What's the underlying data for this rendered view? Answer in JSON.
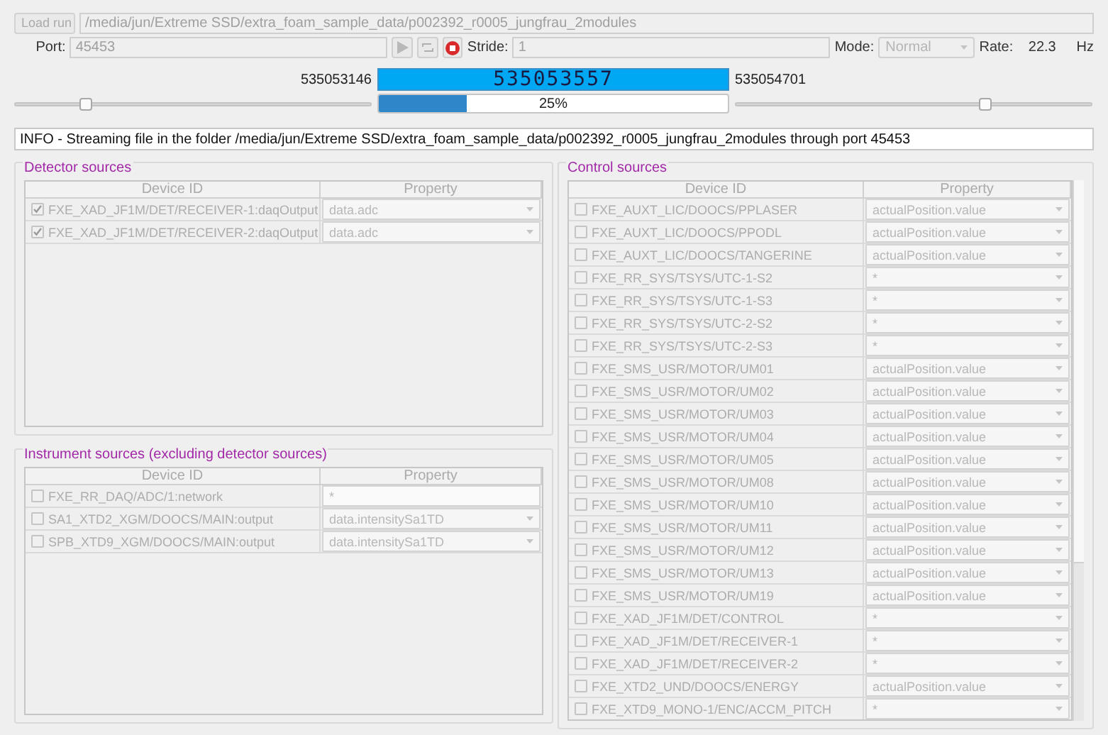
{
  "load_run_button": "Load run",
  "file_path": "/media/jun/Extreme SSD/extra_foam_sample_data/p002392_r0005_jungfrau_2modules",
  "port": {
    "label": "Port:",
    "value": "45453",
    "disabled": true
  },
  "stride": {
    "label": "Stride:",
    "value": "1",
    "disabled": true
  },
  "mode": {
    "label": "Mode:",
    "value": "Normal"
  },
  "rate": {
    "label": "Rate:",
    "value": "22.3",
    "unit": "Hz"
  },
  "stream": {
    "start": "535053146",
    "current": "535053557",
    "end": "535054701",
    "progress": {
      "level": 0.25,
      "label": "25%"
    },
    "start_slider": {
      "level": 0.2
    },
    "end_slider": {
      "level": 0.7
    }
  },
  "info": "INFO - Streaming file in the folder /media/jun/Extreme SSD/extra_foam_sample_data/p002392_r0005_jungfrau_2modules through port 45453",
  "detector_sources": {
    "title": "Detector sources",
    "columns": [
      "Device ID",
      "Property"
    ],
    "rows": [
      {
        "device": "FXE_XAD_JF1M/DET/RECEIVER-1:daqOutput",
        "checked": true,
        "property": "data.adc",
        "kind": "combo"
      },
      {
        "device": "FXE_XAD_JF1M/DET/RECEIVER-2:daqOutput",
        "checked": true,
        "property": "data.adc",
        "kind": "combo"
      }
    ]
  },
  "instrument_sources": {
    "title": "Instrument sources (excluding detector sources)",
    "columns": [
      "Device ID",
      "Property"
    ],
    "rows": [
      {
        "device": "FXE_RR_DAQ/ADC/1:network",
        "checked": false,
        "property": "*",
        "kind": "text"
      },
      {
        "device": "SA1_XTD2_XGM/DOOCS/MAIN:output",
        "checked": false,
        "property": "data.intensitySa1TD",
        "kind": "combo"
      },
      {
        "device": "SPB_XTD9_XGM/DOOCS/MAIN:output",
        "checked": false,
        "property": "data.intensitySa1TD",
        "kind": "combo"
      }
    ]
  },
  "control_sources": {
    "title": "Control sources",
    "columns": [
      "Device ID",
      "Property"
    ],
    "rows": [
      {
        "device": "FXE_AUXT_LIC/DOOCS/PPLASER",
        "checked": false,
        "property": "actualPosition.value",
        "kind": "combo"
      },
      {
        "device": "FXE_AUXT_LIC/DOOCS/PPODL",
        "checked": false,
        "property": "actualPosition.value",
        "kind": "combo"
      },
      {
        "device": "FXE_AUXT_LIC/DOOCS/TANGERINE",
        "checked": false,
        "property": "actualPosition.value",
        "kind": "combo"
      },
      {
        "device": "FXE_RR_SYS/TSYS/UTC-1-S2",
        "checked": false,
        "property": "*",
        "kind": "combo"
      },
      {
        "device": "FXE_RR_SYS/TSYS/UTC-1-S3",
        "checked": false,
        "property": "*",
        "kind": "combo"
      },
      {
        "device": "FXE_RR_SYS/TSYS/UTC-2-S2",
        "checked": false,
        "property": "*",
        "kind": "combo"
      },
      {
        "device": "FXE_RR_SYS/TSYS/UTC-2-S3",
        "checked": false,
        "property": "*",
        "kind": "combo"
      },
      {
        "device": "FXE_SMS_USR/MOTOR/UM01",
        "checked": false,
        "property": "actualPosition.value",
        "kind": "combo"
      },
      {
        "device": "FXE_SMS_USR/MOTOR/UM02",
        "checked": false,
        "property": "actualPosition.value",
        "kind": "combo"
      },
      {
        "device": "FXE_SMS_USR/MOTOR/UM03",
        "checked": false,
        "property": "actualPosition.value",
        "kind": "combo"
      },
      {
        "device": "FXE_SMS_USR/MOTOR/UM04",
        "checked": false,
        "property": "actualPosition.value",
        "kind": "combo"
      },
      {
        "device": "FXE_SMS_USR/MOTOR/UM05",
        "checked": false,
        "property": "actualPosition.value",
        "kind": "combo"
      },
      {
        "device": "FXE_SMS_USR/MOTOR/UM08",
        "checked": false,
        "property": "actualPosition.value",
        "kind": "combo"
      },
      {
        "device": "FXE_SMS_USR/MOTOR/UM10",
        "checked": false,
        "property": "actualPosition.value",
        "kind": "combo"
      },
      {
        "device": "FXE_SMS_USR/MOTOR/UM11",
        "checked": false,
        "property": "actualPosition.value",
        "kind": "combo"
      },
      {
        "device": "FXE_SMS_USR/MOTOR/UM12",
        "checked": false,
        "property": "actualPosition.value",
        "kind": "combo"
      },
      {
        "device": "FXE_SMS_USR/MOTOR/UM13",
        "checked": false,
        "property": "actualPosition.value",
        "kind": "combo"
      },
      {
        "device": "FXE_SMS_USR/MOTOR/UM19",
        "checked": false,
        "property": "actualPosition.value",
        "kind": "combo"
      },
      {
        "device": "FXE_XAD_JF1M/DET/CONTROL",
        "checked": false,
        "property": "*",
        "kind": "combo"
      },
      {
        "device": "FXE_XAD_JF1M/DET/RECEIVER-1",
        "checked": false,
        "property": "*",
        "kind": "combo"
      },
      {
        "device": "FXE_XAD_JF1M/DET/RECEIVER-2",
        "checked": false,
        "property": "*",
        "kind": "combo"
      },
      {
        "device": "FXE_XTD2_UND/DOOCS/ENERGY",
        "checked": false,
        "property": "actualPosition.value",
        "kind": "combo"
      },
      {
        "device": "FXE_XTD9_MONO-1/ENC/ACCM_PITCH",
        "checked": false,
        "property": "*",
        "kind": "combo"
      }
    ]
  }
}
